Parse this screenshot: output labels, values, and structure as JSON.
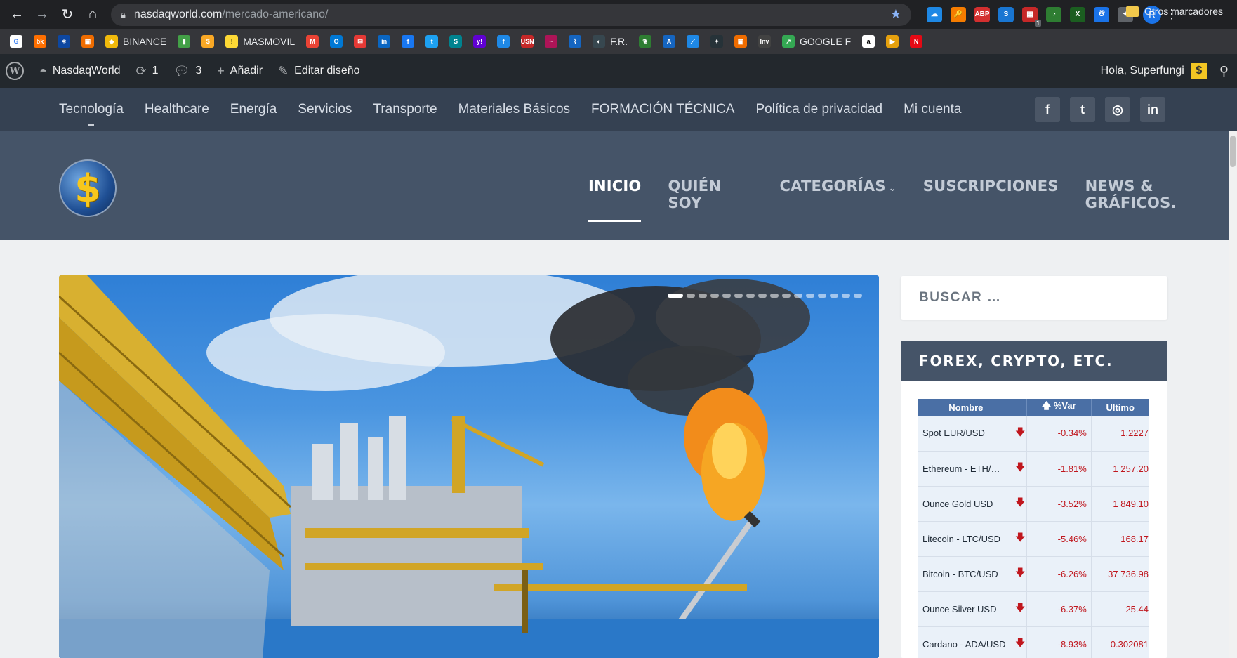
{
  "browser": {
    "url_host": "nasdaqworld.com",
    "url_path": "/mercado-americano/",
    "extensions": [
      {
        "name": "cloud-icon",
        "color": "#1e88e5",
        "text": "☁"
      },
      {
        "name": "key-icon",
        "color": "#f57c00",
        "text": "🔑"
      },
      {
        "name": "adblock-plus-icon",
        "color": "#d32f2f",
        "text": "ABP"
      },
      {
        "name": "s-extension-icon",
        "color": "#1976d2",
        "text": "S"
      },
      {
        "name": "calendar-extension-icon",
        "color": "#c62828",
        "text": "▦",
        "badge": "1"
      },
      {
        "name": "chart-extension-icon",
        "color": "#2e7d32",
        "text": "◔"
      },
      {
        "name": "excel-icon",
        "color": "#1b5e20",
        "text": "X"
      },
      {
        "name": "translate-icon",
        "color": "#1a73e8",
        "text": "G"
      },
      {
        "name": "puzzle-icon",
        "color": "#5f6368",
        "text": "✦"
      }
    ],
    "profile_initial": "R",
    "bookmarks": [
      {
        "name": "google",
        "label": "",
        "color": "#ffffff",
        "text": "G",
        "text_color": "#4285f4"
      },
      {
        "name": "bk",
        "label": "",
        "color": "#ff6f00",
        "text": "bk"
      },
      {
        "name": "caixabank",
        "label": "",
        "color": "#0d47a1",
        "text": "✶"
      },
      {
        "name": "orange-square",
        "label": "",
        "color": "#ef6c00",
        "text": "▣"
      },
      {
        "name": "binance",
        "label": "BINANCE",
        "color": "#f0b90b",
        "text": "◆"
      },
      {
        "name": "bars",
        "label": "",
        "color": "#43a047",
        "text": "▮"
      },
      {
        "name": "coin",
        "label": "",
        "color": "#f9a825",
        "text": "$"
      },
      {
        "name": "masmovil",
        "label": "MASMOVIL",
        "color": "#fdd835",
        "text": "!",
        "text_color": "#000"
      },
      {
        "name": "gmail",
        "label": "",
        "color": "#ea4335",
        "text": "M"
      },
      {
        "name": "outlook",
        "label": "",
        "color": "#0078d4",
        "text": "O"
      },
      {
        "name": "mail",
        "label": "",
        "color": "#e53935",
        "text": "✉"
      },
      {
        "name": "linkedin",
        "label": "",
        "color": "#0a66c2",
        "text": "in"
      },
      {
        "name": "facebook",
        "label": "",
        "color": "#1877f2",
        "text": "f"
      },
      {
        "name": "twitter",
        "label": "",
        "color": "#1da1f2",
        "text": "t"
      },
      {
        "name": "s-link",
        "label": "",
        "color": "#00838f",
        "text": "S"
      },
      {
        "name": "yahoo",
        "label": "",
        "color": "#6001d2",
        "text": "y!"
      },
      {
        "name": "f-circle",
        "label": "",
        "color": "#1e88e5",
        "text": "f"
      },
      {
        "name": "usn",
        "label": "",
        "color": "#c62828",
        "text": "USN"
      },
      {
        "name": "wave",
        "label": "",
        "color": "#ad1457",
        "text": "~"
      },
      {
        "name": "pulse",
        "label": "",
        "color": "#1565c0",
        "text": "⌇"
      },
      {
        "name": "fr",
        "label": "F.R.",
        "color": "#37474f",
        "text": "◐"
      },
      {
        "name": "green-leaf",
        "label": "",
        "color": "#2e7d32",
        "text": "❦"
      },
      {
        "name": "a-logo",
        "label": "",
        "color": "#1565c0",
        "text": "A"
      },
      {
        "name": "trend",
        "label": "",
        "color": "#1e88e5",
        "text": "⟋"
      },
      {
        "name": "bird",
        "label": "",
        "color": "#263238",
        "text": "✦"
      },
      {
        "name": "orange-square-2",
        "label": "",
        "color": "#ef6c00",
        "text": "▣"
      },
      {
        "name": "investing",
        "label": "",
        "color": "#424242",
        "text": "Inv"
      },
      {
        "name": "google-finance",
        "label": "GOOGLE F",
        "color": "#34a853",
        "text": "↗"
      },
      {
        "name": "amazon",
        "label": "",
        "color": "#ffffff",
        "text": "a",
        "text_color": "#000"
      },
      {
        "name": "plex",
        "label": "",
        "color": "#e5a00d",
        "text": "▶"
      },
      {
        "name": "netflix",
        "label": "",
        "color": "#e50914",
        "text": "N"
      }
    ],
    "bookmarks_more": "»",
    "other_bookmarks": "Otros marcadores"
  },
  "wpbar": {
    "site_name": "NasdaqWorld",
    "updates_count": "1",
    "comments_count": "3",
    "add_label": "Añadir",
    "edit_label": "Editar diseño",
    "greeting": "Hola, Superfungi",
    "avatar_text": "$"
  },
  "topnav": {
    "items": [
      "Tecnología",
      "Healthcare",
      "Energía",
      "Servicios",
      "Transporte",
      "Materiales Básicos",
      "FORMACIÓN TÉCNICA",
      "Política de privacidad",
      "Mi cuenta"
    ],
    "social": [
      "f",
      "t",
      "◎",
      "in"
    ]
  },
  "header": {
    "logo_text": "$",
    "nav": [
      "INICIO",
      "QUIÉN SOY",
      "CATEGORÍAS",
      "SUSCRIPCIONES",
      "NEWS & GRÁFICOS."
    ],
    "dropdown_chevron": "⌄"
  },
  "slider": {
    "dot_count": 16,
    "active_dot": 0
  },
  "sidebar": {
    "search_placeholder": "BUSCAR …",
    "widget_title": "FOREX, CRYPTO, ETC.",
    "table_headers": [
      "Nombre",
      "%Var",
      "Ultimo"
    ],
    "sort_arrow": "🡅",
    "rows": [
      {
        "name": "Spot EUR/USD",
        "var": "-0.34%",
        "last": "1.2227"
      },
      {
        "name": "Ethereum - ETH/…",
        "var": "-1.81%",
        "last": "1 257.20"
      },
      {
        "name": "Ounce Gold USD",
        "var": "-3.52%",
        "last": "1 849.10"
      },
      {
        "name": "Litecoin - LTC/USD",
        "var": "-5.46%",
        "last": "168.17"
      },
      {
        "name": "Bitcoin - BTC/USD",
        "var": "-6.26%",
        "last": "37 736.98"
      },
      {
        "name": "Ounce Silver USD",
        "var": "-6.37%",
        "last": "25.44"
      },
      {
        "name": "Cardano - ADA/USD",
        "var": "-8.93%",
        "last": "0.302081"
      }
    ],
    "down_arrow": "🡇"
  }
}
